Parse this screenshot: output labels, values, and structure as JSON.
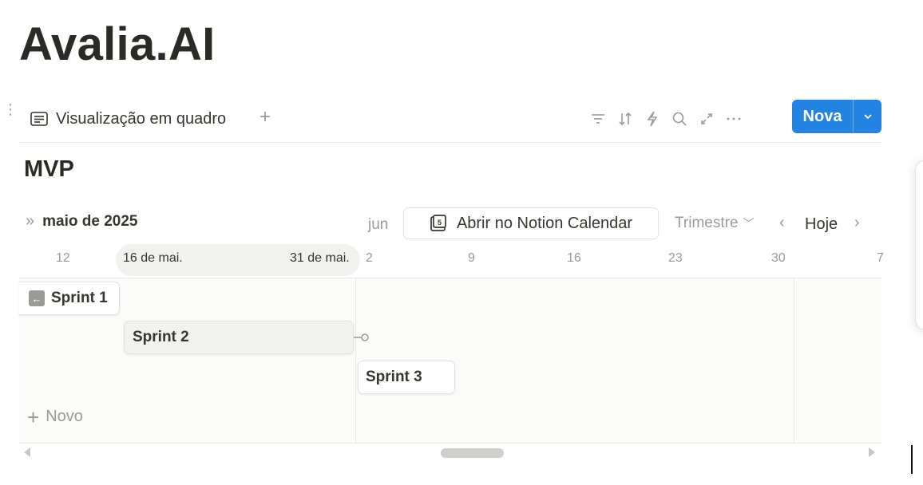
{
  "page": {
    "title": "Avalia.AI"
  },
  "toolbar": {
    "view_label": "Visualização em quadro",
    "add_view": "+",
    "new_button": "Nova",
    "tools": [
      "filter-icon",
      "sort-icon",
      "automation-icon",
      "search-icon",
      "expand-icon",
      "more-icon"
    ]
  },
  "group": {
    "title": "MVP"
  },
  "timeline": {
    "month": "maio de 2025",
    "next_month": "jun",
    "open_calendar": "Abrir no Notion Calendar",
    "period": "Trimestre",
    "today": "Hoje",
    "dates": {
      "d12": "12",
      "range_start": "16 de mai.",
      "range_end": "31 de mai.",
      "d2": "2",
      "d9": "9",
      "d16": "16",
      "d23": "23",
      "d30": "30",
      "d7": "7"
    },
    "sprints": [
      {
        "name": "Sprint 1"
      },
      {
        "name": "Sprint 2"
      },
      {
        "name": "Sprint 3"
      }
    ],
    "new_item": "Novo"
  },
  "colors": {
    "accent": "#2383e2",
    "text": "#37352f",
    "muted": "#9b9a97",
    "border": "#e9e9e7"
  }
}
